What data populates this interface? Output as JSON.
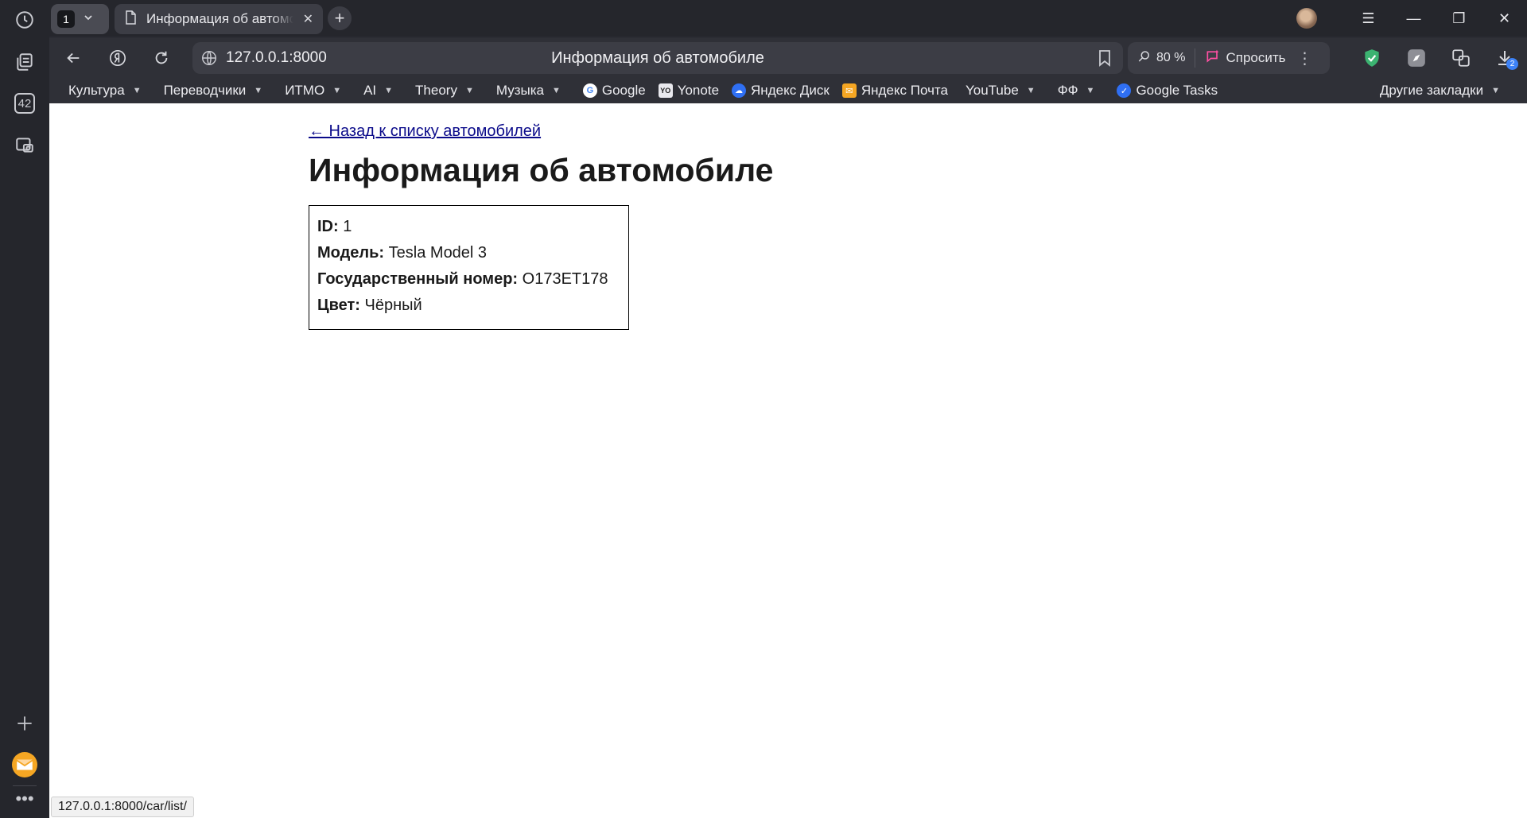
{
  "browser": {
    "tab_count": "1",
    "active_tab_title": "Информация об автомобиле",
    "url": "127.0.0.1:8000",
    "omnibox_title": "Информация об автомобиле",
    "zoom": "80 %",
    "ask_label": "Спросить",
    "sidebar_counter": "42",
    "download_badge": "2"
  },
  "bookmarks": [
    {
      "label": "Культура",
      "folder": true
    },
    {
      "label": "Переводчики",
      "folder": true
    },
    {
      "label": "ИТМО",
      "folder": true
    },
    {
      "label": "AI",
      "folder": true
    },
    {
      "label": "Theory",
      "folder": true
    },
    {
      "label": "Музыка",
      "folder": true
    },
    {
      "label": "Google",
      "folder": false,
      "icon": "google-icon"
    },
    {
      "label": "Yonote",
      "folder": false,
      "icon": "yonote-icon"
    },
    {
      "label": "Яндекс Диск",
      "folder": false,
      "icon": "yandex-disk-icon"
    },
    {
      "label": "Яндекс Почта",
      "folder": false,
      "icon": "yandex-mail-icon"
    },
    {
      "label": "YouTube",
      "folder": true
    },
    {
      "label": "ФФ",
      "folder": true
    },
    {
      "label": "Google Tasks",
      "folder": false,
      "icon": "google-tasks-icon"
    }
  ],
  "other_bookmarks": "Другие закладки",
  "page": {
    "back_link": "← Назад к списку автомобилей",
    "title": "Информация об автомобиле",
    "fields": [
      {
        "label": "ID:",
        "value": "1"
      },
      {
        "label": "Модель:",
        "value": "Tesla Model 3"
      },
      {
        "label": "Государственный номер:",
        "value": "O173ET178"
      },
      {
        "label": "Цвет:",
        "value": "Чёрный"
      }
    ]
  },
  "status_url": "127.0.0.1:8000/car/list/"
}
